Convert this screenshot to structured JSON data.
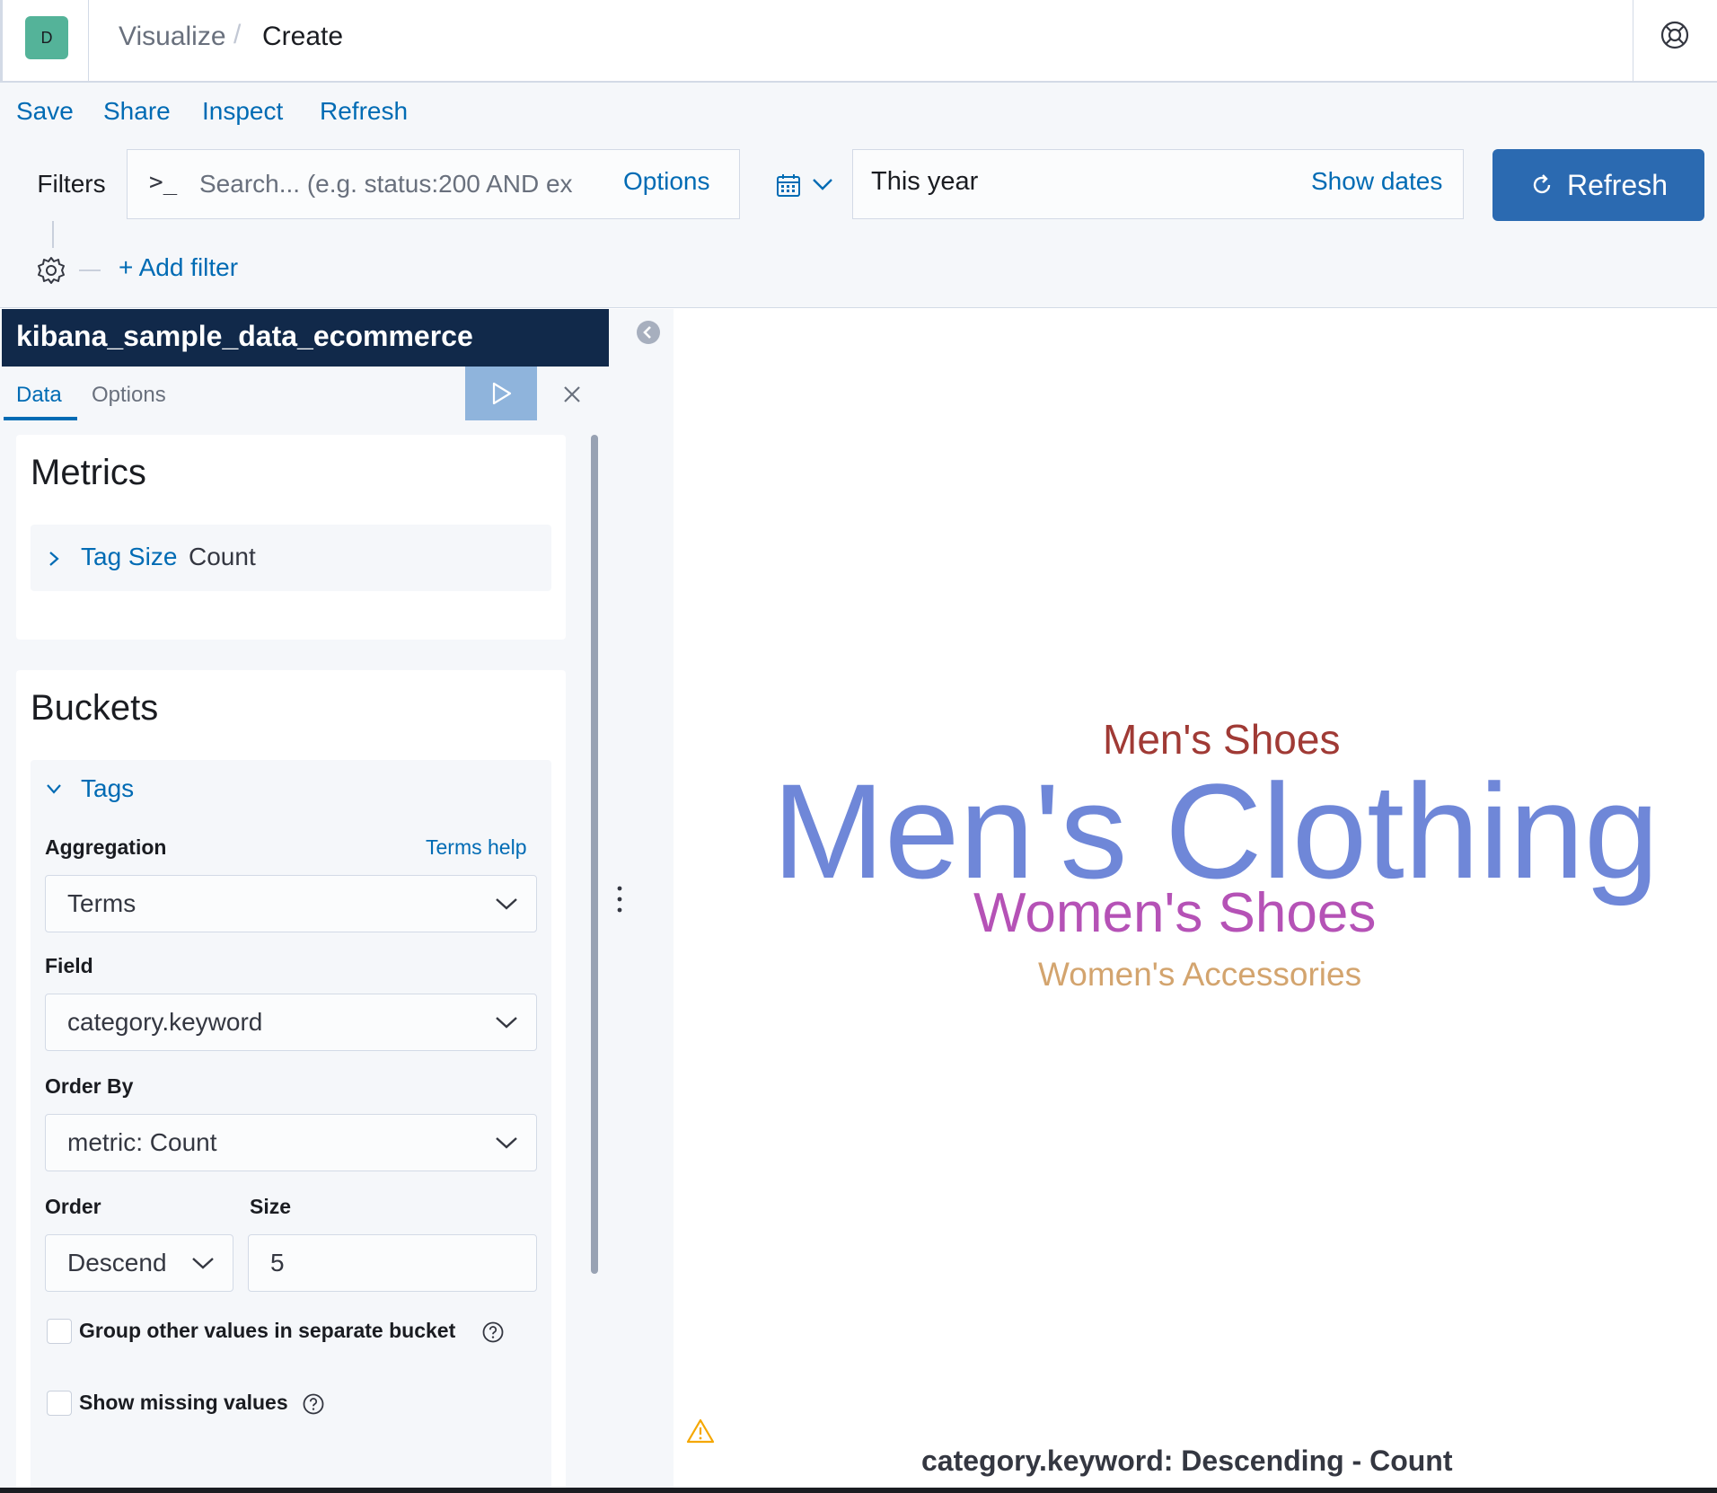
{
  "header": {
    "avatar_letter": "D",
    "breadcrumbs": [
      "Visualize",
      "Create"
    ],
    "separator": "/",
    "help_icon": "help-icon"
  },
  "toolbar": {
    "links": [
      "Save",
      "Share",
      "Inspect",
      "Refresh"
    ]
  },
  "query": {
    "filters_label": "Filters",
    "prompt": ">_",
    "search_placeholder": "Search... (e.g. status:200 AND ex",
    "options_label": "Options"
  },
  "time": {
    "value": "This year",
    "show_dates_label": "Show dates",
    "refresh_label": "Refresh"
  },
  "filters": {
    "add_filter_label": "+ Add filter"
  },
  "sidebar": {
    "index_pattern": "kibana_sample_data_ecommerce",
    "tabs": [
      "Data",
      "Options"
    ],
    "active_tab": "Data",
    "metrics": {
      "title": "Metrics",
      "item_name": "Tag Size",
      "item_value": "Count"
    },
    "buckets": {
      "title": "Buckets",
      "item_name": "Tags",
      "aggregation_label": "Aggregation",
      "terms_help_label": "Terms help",
      "aggregation_value": "Terms",
      "field_label": "Field",
      "field_value": "category.keyword",
      "order_by_label": "Order By",
      "order_by_value": "metric: Count",
      "order_label": "Order",
      "order_value": "Descend",
      "size_label": "Size",
      "size_value": "5",
      "group_other_label": "Group other values in separate bucket",
      "group_other_checked": false,
      "show_missing_label": "Show missing values",
      "show_missing_checked": false
    }
  },
  "visualization": {
    "caption": "category.keyword: Descending - Count",
    "words": [
      {
        "text": "Men's Shoes",
        "color": "#a03a35"
      },
      {
        "text": "Men's Clothing",
        "color": "#6f87d8"
      },
      {
        "text": "Women's Shoes",
        "color": "#b552b6"
      },
      {
        "text": "Women's Accessories",
        "color": "#d3a46e"
      }
    ]
  },
  "colors": {
    "link": "#006bb4",
    "primary_button": "#2b6ab1",
    "index_header": "#11294a",
    "avatar": "#54b399"
  }
}
